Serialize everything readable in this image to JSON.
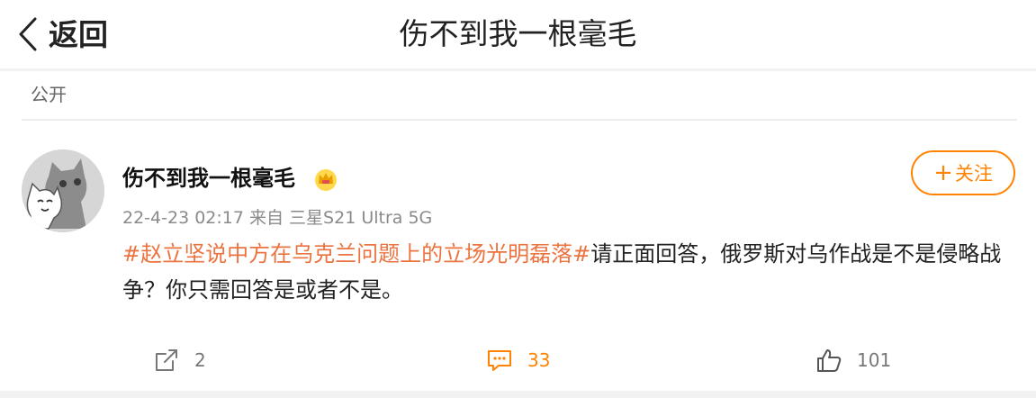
{
  "header": {
    "back_label": "返回",
    "title": "伤不到我一根毫毛"
  },
  "visibility": "公开",
  "post": {
    "username": "伤不到我一根毫毛",
    "badge_icon": "crown-badge-icon",
    "timestamp": "22-4-23 02:17",
    "source": "来自 三星S21 Ultra 5G",
    "follow_label": "关注",
    "hashtag": "#赵立坚说中方在乌克兰问题上的立场光明磊落#",
    "body": "请正面回答，俄罗斯对乌作战是不是侵略战争？你只需回答是或者不是。"
  },
  "actions": {
    "repost_count": "2",
    "comment_count": "33",
    "like_count": "101"
  },
  "colors": {
    "accent": "#ff8200",
    "hashtag": "#eb7340"
  }
}
